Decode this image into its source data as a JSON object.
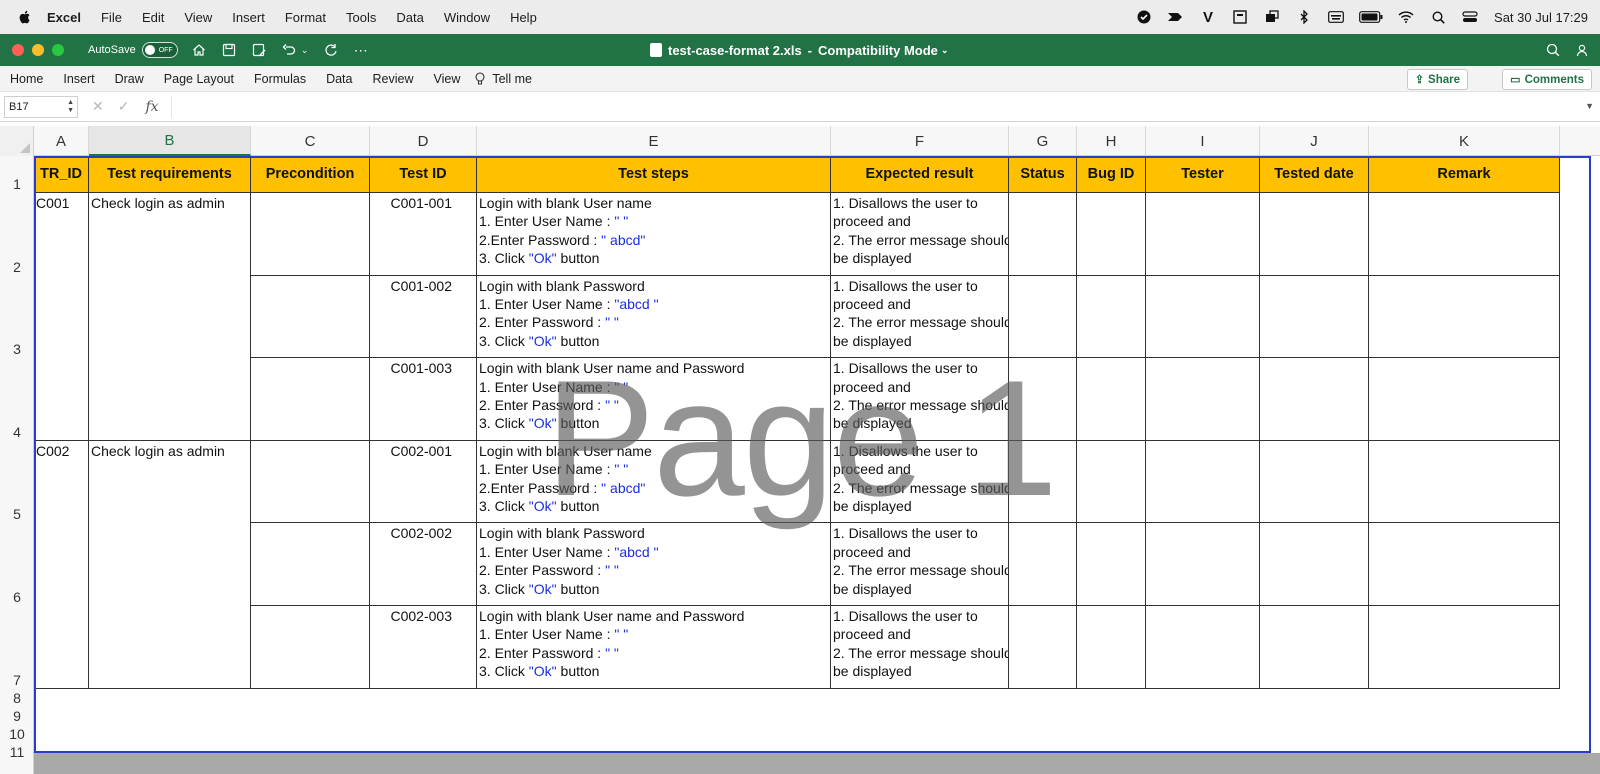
{
  "menubar": {
    "app_name": "Excel",
    "items": [
      "File",
      "Edit",
      "View",
      "Insert",
      "Format",
      "Tools",
      "Data",
      "Window",
      "Help"
    ],
    "clock": "Sat 30 Jul  17:29"
  },
  "titlebar": {
    "autosave_label": "AutoSave",
    "autosave_state": "OFF",
    "filename": "test-case-format 2.xls",
    "separator": "-",
    "mode": "Compatibility Mode"
  },
  "ribbon": {
    "tabs": [
      "Home",
      "Insert",
      "Draw",
      "Page Layout",
      "Formulas",
      "Data",
      "Review",
      "View"
    ],
    "tell_me": "Tell me",
    "share": "Share",
    "comments": "Comments"
  },
  "formula_bar": {
    "name_box": "B17",
    "fx": "fx",
    "value": ""
  },
  "columns": [
    "A",
    "B",
    "C",
    "D",
    "E",
    "F",
    "G",
    "H",
    "I",
    "J",
    "K"
  ],
  "selected_column": "B",
  "rows": [
    "1",
    "2",
    "3",
    "4",
    "5",
    "6",
    "7",
    "8",
    "9",
    "10",
    "11"
  ],
  "table": {
    "headers": [
      "TR_ID",
      "Test requirements",
      "Precondition",
      "Test  ID",
      "Test steps",
      "Expected result",
      "Status",
      "Bug ID",
      "Tester",
      "Tested date",
      "Remark"
    ],
    "groups": [
      {
        "tr_id": "C001",
        "requirement": "Check login as admin"
      },
      {
        "tr_id": "C002",
        "requirement": "Check login as admin"
      }
    ],
    "cases": [
      {
        "test_id": "C001-001",
        "steps": [
          "Login with blank User name",
          "1. Enter User Name : \" \"",
          "2.Enter Password : \" abcd\"",
          "3. Click \"Ok\" button"
        ]
      },
      {
        "test_id": "C001-002",
        "steps": [
          "Login with blank Password",
          "1. Enter User Name : \"abcd \"",
          "2. Enter Password : \" \"",
          "3. Click \"Ok\" button"
        ]
      },
      {
        "test_id": "C001-003",
        "steps": [
          "Login with blank User name and Password",
          "1. Enter User Name : \" \"",
          "2. Enter Password : \" \"",
          "3. Click \"Ok\" button"
        ]
      },
      {
        "test_id": "C002-001",
        "steps": [
          "Login with blank User name",
          "1. Enter User Name : \" \"",
          "2.Enter Password : \" abcd\"",
          "3. Click \"Ok\" button"
        ]
      },
      {
        "test_id": "C002-002",
        "steps": [
          "Login with blank Password",
          "1. Enter User Name : \"abcd \"",
          "2. Enter Password : \" \"",
          "3. Click \"Ok\" button"
        ]
      },
      {
        "test_id": "C002-003",
        "steps": [
          "Login with blank User name and Password",
          "1. Enter User Name : \" \"",
          "2. Enter Password : \" \"",
          "3. Click \"Ok\" button"
        ]
      }
    ],
    "expected_result": [
      "1. Disallows the user to",
      "proceed and",
      "2. The error message should",
      "be displayed"
    ]
  },
  "watermark": "Page 1",
  "colors": {
    "excel_green": "#217346",
    "header_fill": "#ffc000",
    "link_blue": "#1a2ee0",
    "page_border": "#2a3cc8"
  }
}
